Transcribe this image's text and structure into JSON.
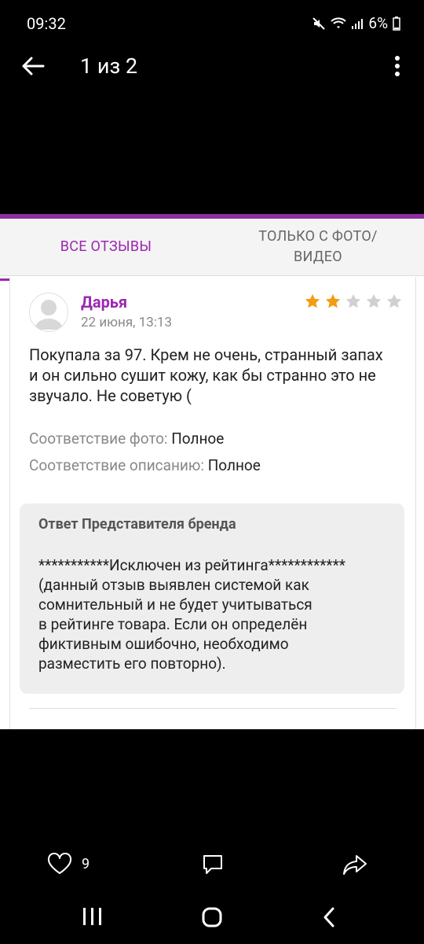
{
  "status_bar": {
    "time": "09:32",
    "battery": "6%"
  },
  "viewer": {
    "title": "1 из 2"
  },
  "tabs": [
    {
      "label": "ВСЕ ОТЗЫВЫ"
    },
    {
      "label": "ТОЛЬКО С ФОТО/ ВИДЕО"
    }
  ],
  "review": {
    "author": "Дарья",
    "date": "22 июня, 13:13",
    "rating": 2,
    "rating_max": 5,
    "text": "Покупала за 97. Крем не очень, странный запах и он сильно сушит кожу, как бы странно это не звучало. Не советую (",
    "photo_match": {
      "label": "Соответствие фото:",
      "value": "Полное"
    },
    "description_match": {
      "label": "Соответствие описанию:",
      "value": "Полное"
    },
    "reply": {
      "title": "Ответ Представителя бренда",
      "text": "***********Исключен из рейтинга************\n(данный отзыв выявлен системой как\nсомнительный и не будет учитываться\nв рейтинге товара. Если он определён\nфиктивным ошибочно, необходимо\nразместить его повторно)."
    }
  },
  "actions": {
    "likes": "9"
  },
  "colors": {
    "accent": "#9b27b0",
    "star": "#f39c12",
    "star_empty": "#d0d0d0"
  }
}
